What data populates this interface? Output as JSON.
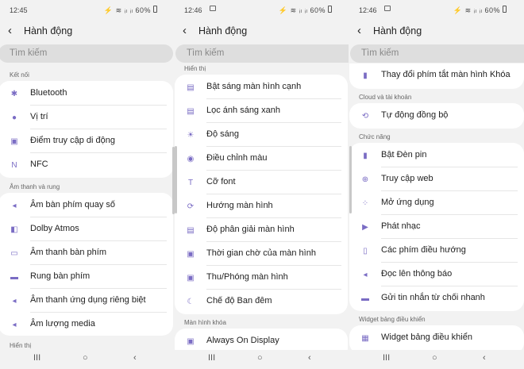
{
  "status": {
    "p1": {
      "time": "12:45",
      "icons": "⚡ ≋ ᵢₗ ᵢₗ 60%"
    },
    "p2": {
      "time": "12:46",
      "icons": "⚡ ≋ ᵢₗ ᵢₗ 60%"
    },
    "p3": {
      "time": "12:46",
      "icons": "⚡ ≋ ᵢₗ ᵢₗ 60%"
    }
  },
  "header": {
    "title": "Hành động",
    "back": "‹"
  },
  "search": {
    "placeholder": "Tìm kiếm"
  },
  "panel1": {
    "sec_connections": "Kết nối",
    "connections": [
      {
        "label": "Bluetooth",
        "icon": "bluetooth-icon",
        "glyph": "✱"
      },
      {
        "label": "Vị trí",
        "icon": "location-pin-icon",
        "glyph": "●"
      },
      {
        "label": "Điểm truy cập di động",
        "icon": "hotspot-icon",
        "glyph": "▣"
      },
      {
        "label": "NFC",
        "icon": "nfc-icon",
        "glyph": "N"
      }
    ],
    "sec_sound": "Âm thanh và rung",
    "sound": [
      {
        "label": "Âm bàn phím quay số",
        "icon": "speaker-icon",
        "glyph": "◂"
      },
      {
        "label": "Dolby Atmos",
        "icon": "dolby-icon",
        "glyph": "◧"
      },
      {
        "label": "Âm thanh bàn phím",
        "icon": "keyboard-sound-icon",
        "glyph": "▭"
      },
      {
        "label": "Rung bàn phím",
        "icon": "vibrate-icon",
        "glyph": "▬"
      },
      {
        "label": "Âm thanh ứng dụng riêng biệt",
        "icon": "app-sound-icon",
        "glyph": "◂"
      },
      {
        "label": "Âm lượng media",
        "icon": "volume-icon",
        "glyph": "◂"
      }
    ],
    "sec_display": "Hiển thị"
  },
  "panel2": {
    "sec_display": "Hiển thị",
    "display": [
      {
        "label": "Bật sáng màn hình cạnh",
        "icon": "edge-lighting-icon",
        "glyph": "▤"
      },
      {
        "label": "Lọc ánh sáng xanh",
        "icon": "blue-light-filter-icon",
        "glyph": "▤"
      },
      {
        "label": "Độ sáng",
        "icon": "brightness-icon",
        "glyph": "☀"
      },
      {
        "label": "Điều chỉnh màu",
        "icon": "palette-icon",
        "glyph": "◉"
      },
      {
        "label": "Cỡ font",
        "icon": "font-size-icon",
        "glyph": "T"
      },
      {
        "label": "Hướng màn hình",
        "icon": "rotate-icon",
        "glyph": "⟳"
      },
      {
        "label": "Độ phân giải màn hình",
        "icon": "resolution-icon",
        "glyph": "▤"
      },
      {
        "label": "Thời gian chờ của màn hình",
        "icon": "screen-timeout-icon",
        "glyph": "▣"
      },
      {
        "label": "Thu/Phóng màn hình",
        "icon": "zoom-icon",
        "glyph": "▣"
      },
      {
        "label": "Chế độ Ban đêm",
        "icon": "moon-icon",
        "glyph": "☾"
      }
    ],
    "sec_lock": "Màn hình khóa",
    "lock": [
      {
        "label": "Always On Display",
        "icon": "always-on-display-icon",
        "glyph": "▣"
      }
    ]
  },
  "panel3": {
    "top": [
      {
        "label": "Thay đổi phím tắt màn hình Khóa",
        "icon": "lock-shortcut-icon",
        "glyph": "▮"
      }
    ],
    "sec_cloud": "Cloud và tài khoản",
    "cloud": [
      {
        "label": "Tự động đồng bộ",
        "icon": "sync-icon",
        "glyph": "⟲"
      }
    ],
    "sec_functions": "Chức năng",
    "functions": [
      {
        "label": "Bật Đèn pin",
        "icon": "flashlight-icon",
        "glyph": "▮"
      },
      {
        "label": "Truy cập web",
        "icon": "globe-icon",
        "glyph": "⊕"
      },
      {
        "label": "Mở ứng dụng",
        "icon": "apps-grid-icon",
        "glyph": "⁘"
      },
      {
        "label": "Phát nhạc",
        "icon": "play-icon",
        "glyph": "▶"
      },
      {
        "label": "Các phím điều hướng",
        "icon": "navigation-keys-icon",
        "glyph": "▯"
      },
      {
        "label": "Đọc lên thông báo",
        "icon": "read-notification-icon",
        "glyph": "◂"
      },
      {
        "label": "Gửi tin nhắn từ chối nhanh",
        "icon": "message-icon",
        "glyph": "▬"
      }
    ],
    "sec_widget": "Widget bảng điều khiển",
    "widget": [
      {
        "label": "Widget bảng điều khiển",
        "icon": "widget-icon",
        "glyph": "▦"
      }
    ]
  },
  "navbar": {
    "recents": "III",
    "home": "○",
    "back": "‹"
  },
  "colors": {
    "accent": "#8b7fd0",
    "background": "#f2f2f2",
    "card": "#ffffff"
  }
}
